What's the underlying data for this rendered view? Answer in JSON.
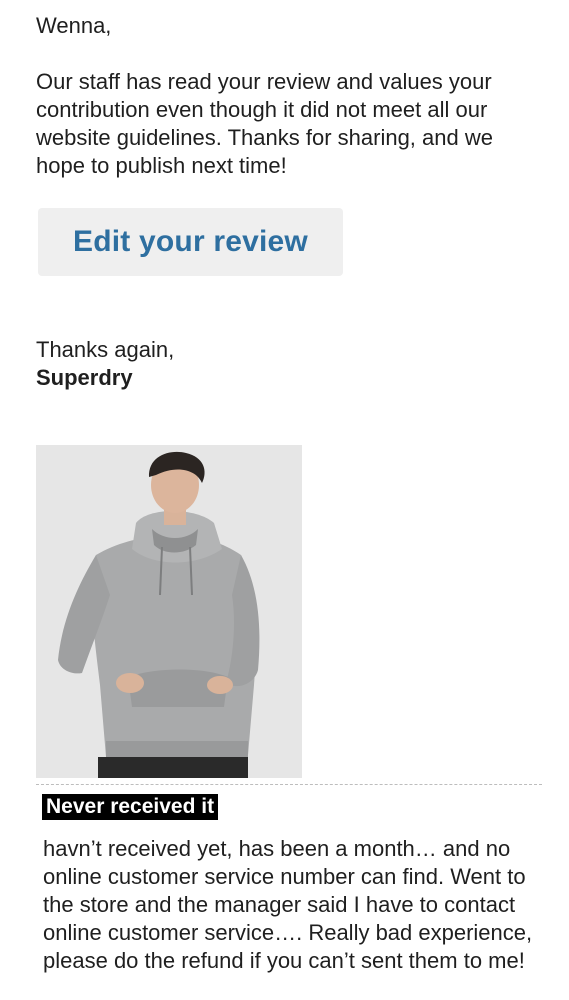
{
  "email": {
    "greeting": "Wenna,",
    "message": "Our staff has read your review and values your contribution even though it did not meet all our website guidelines. Thanks for sharing, and we hope to publish next time!",
    "edit_button_label": "Edit your review",
    "signoff": "Thanks again,",
    "brand": "Superdry"
  },
  "review": {
    "product_image_icon": "grey-hoodie-model-photo",
    "title": "Never received it",
    "body": "havn’t received yet,  has been a month… and no online customer service number can find. Went to the store and the manager said I have to contact online customer service…. Really bad experience, please do the refund if you can’t sent them to me!"
  },
  "colors": {
    "button_bg": "#efefef",
    "button_text": "#2e6fa0",
    "title_bg": "#000000",
    "title_text": "#ffffff"
  }
}
